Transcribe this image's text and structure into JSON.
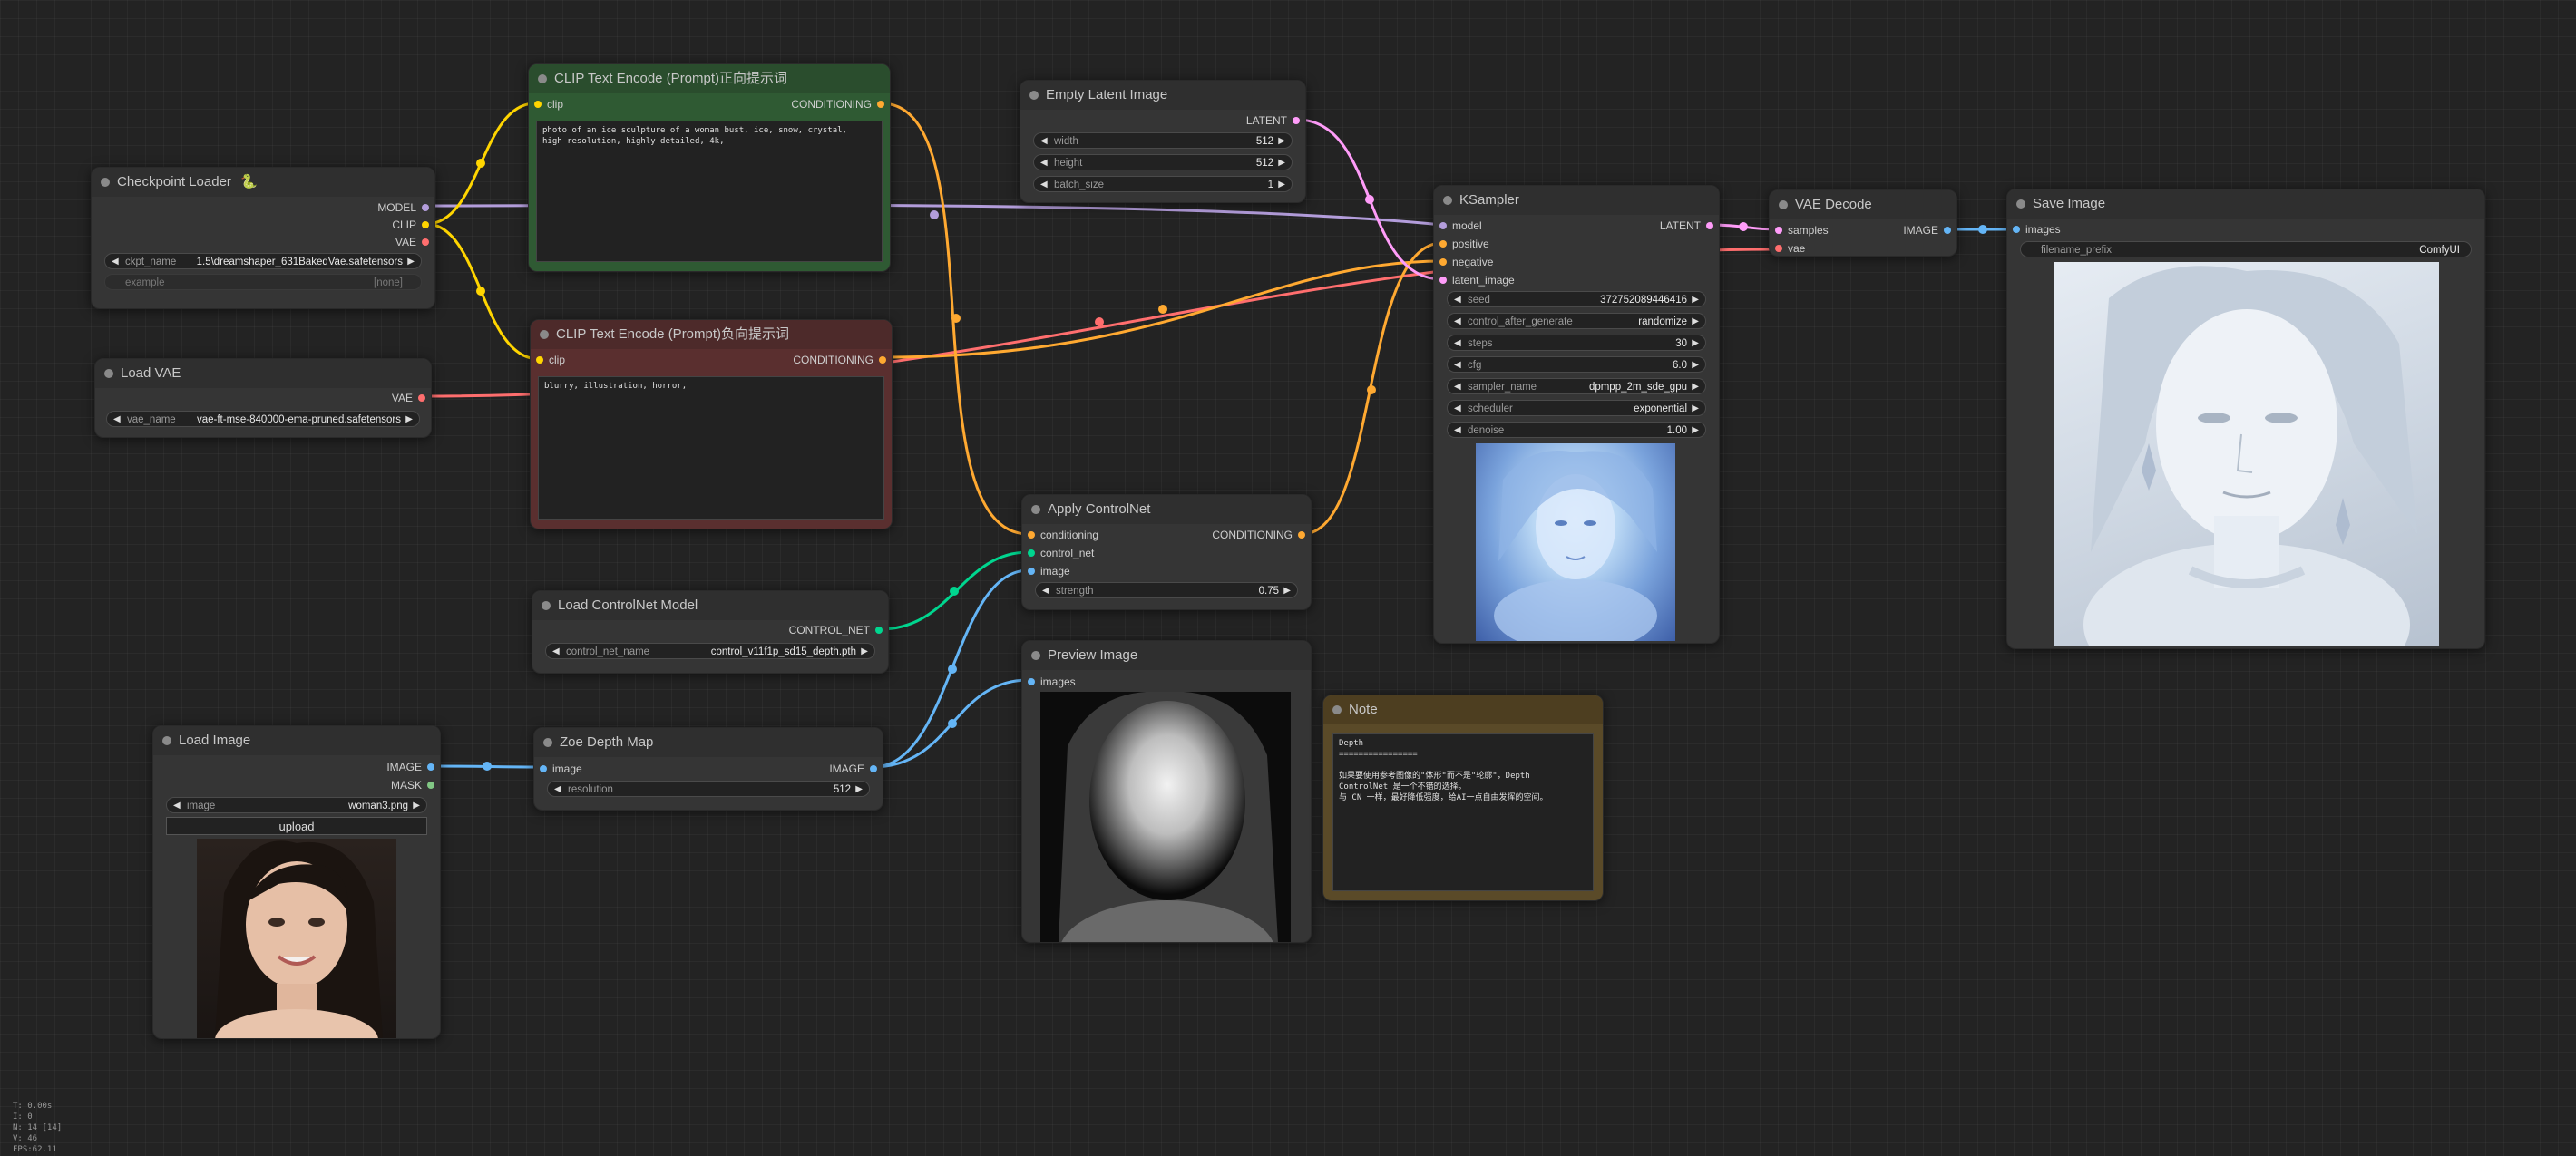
{
  "nodes": {
    "checkpoint_loader": {
      "title": "Checkpoint Loader",
      "badge": "🐍",
      "outputs": [
        "MODEL",
        "CLIP",
        "VAE"
      ],
      "ckpt_label": "ckpt_name",
      "ckpt_value": "1.5\\dreamshaper_631BakedVae.safetensors",
      "example_label": "example",
      "example_value": "[none]"
    },
    "load_vae": {
      "title": "Load VAE",
      "output": "VAE",
      "vae_label": "vae_name",
      "vae_value": "vae-ft-mse-840000-ema-pruned.safetensors"
    },
    "clip_pos": {
      "title": "CLIP Text Encode (Prompt)正向提示词",
      "input": "clip",
      "output": "CONDITIONING",
      "text": "photo of an ice sculpture of a woman bust, ice, snow, crystal,\nhigh resolution, highly detailed, 4k,"
    },
    "clip_neg": {
      "title": "CLIP Text Encode (Prompt)负向提示词",
      "input": "clip",
      "output": "CONDITIONING",
      "text": "blurry, illustration, horror,"
    },
    "empty_latent": {
      "title": "Empty Latent Image",
      "output": "LATENT",
      "widgets": [
        {
          "label": "width",
          "value": "512"
        },
        {
          "label": "height",
          "value": "512"
        },
        {
          "label": "batch_size",
          "value": "1"
        }
      ]
    },
    "ksampler": {
      "title": "KSampler",
      "inputs": [
        "model",
        "positive",
        "negative",
        "latent_image"
      ],
      "output": "LATENT",
      "widgets": [
        {
          "label": "seed",
          "value": "372752089446416"
        },
        {
          "label": "control_after_generate",
          "value": "randomize"
        },
        {
          "label": "steps",
          "value": "30"
        },
        {
          "label": "cfg",
          "value": "6.0"
        },
        {
          "label": "sampler_name",
          "value": "dpmpp_2m_sde_gpu"
        },
        {
          "label": "scheduler",
          "value": "exponential"
        },
        {
          "label": "denoise",
          "value": "1.00"
        }
      ]
    },
    "vae_decode": {
      "title": "VAE Decode",
      "inputs": [
        "samples",
        "vae"
      ],
      "output": "IMAGE"
    },
    "save_image": {
      "title": "Save Image",
      "input": "images",
      "prefix_label": "filename_prefix",
      "prefix_value": "ComfyUI"
    },
    "apply_controlnet": {
      "title": "Apply ControlNet",
      "inputs": [
        "conditioning",
        "control_net",
        "image"
      ],
      "output": "CONDITIONING",
      "strength_label": "strength",
      "strength_value": "0.75"
    },
    "load_controlnet": {
      "title": "Load ControlNet Model",
      "output": "CONTROL_NET",
      "name_label": "control_net_name",
      "name_value": "control_v11f1p_sd15_depth.pth"
    },
    "load_image": {
      "title": "Load Image",
      "outputs": [
        "IMAGE",
        "MASK"
      ],
      "image_label": "image",
      "image_value": "woman3.png",
      "upload_label": "upload"
    },
    "zoe_depth": {
      "title": "Zoe Depth Map",
      "input": "image",
      "output": "IMAGE",
      "res_label": "resolution",
      "res_value": "512"
    },
    "preview_image": {
      "title": "Preview Image",
      "input": "images"
    },
    "note": {
      "title": "Note",
      "text": "Depth\n================\n\n如果要使用参考图像的\"体形\"而不是\"轮廓\"，Depth\nControlNet 是一个不错的选择。\n与 CN 一样，最好降低强度，给AI一点自由发挥的空间。"
    }
  },
  "stats": [
    "T: 0.00s",
    "I: 0",
    "N: 14 [14]",
    "V: 46",
    "FPS:62.11"
  ],
  "colors": {
    "model": "#b39ddb",
    "clip": "#ffd500",
    "vae": "#ff6e6e",
    "conditioning": "#ffa931",
    "latent": "#ff9cf9",
    "image": "#64b5f6",
    "mask": "#81c784",
    "control_net": "#00d68f"
  }
}
